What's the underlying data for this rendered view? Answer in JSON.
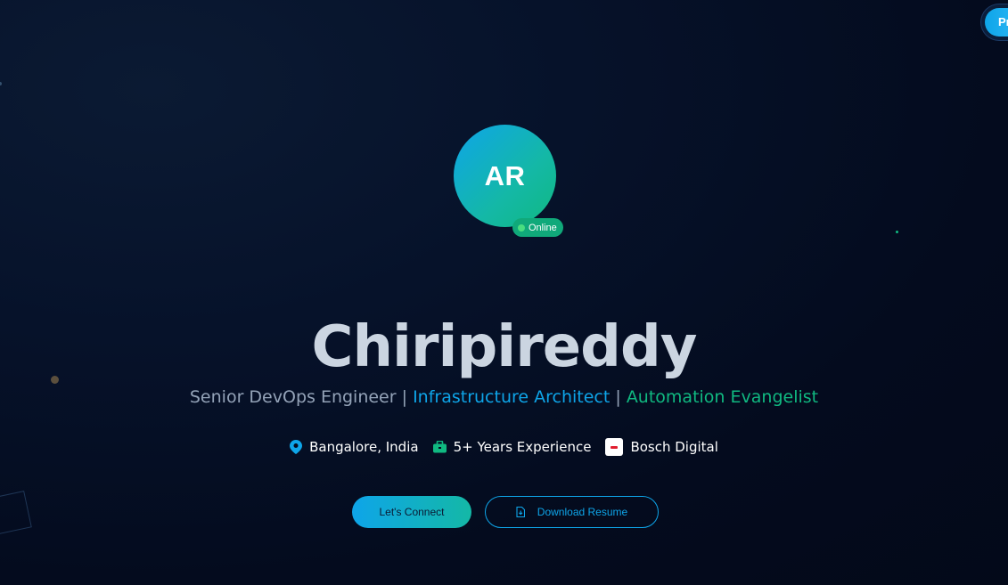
{
  "corner_button": {
    "label": "Pr"
  },
  "profile": {
    "initials": "AR",
    "status": "Online",
    "name": "Chiripireddy"
  },
  "subtitle": {
    "role_1": "Senior DevOps Engineer",
    "separator": "|",
    "role_2": "Infrastructure Architect",
    "role_3": "Automation Evangelist"
  },
  "meta": {
    "location": "Bangalore, India",
    "location_icon": "map-pin-icon",
    "experience": "5+ Years Experience",
    "experience_icon": "briefcase-icon",
    "company": "Bosch Digital",
    "company_icon": "bosch-logo"
  },
  "actions": {
    "connect_label": "Let's Connect",
    "resume_label": "Download Resume",
    "resume_icon": "file-download-icon"
  },
  "colors": {
    "accent_blue": "#0ea5e9",
    "accent_green": "#10b981",
    "background": "#040b1e",
    "name_text": "#cbd5e1"
  }
}
